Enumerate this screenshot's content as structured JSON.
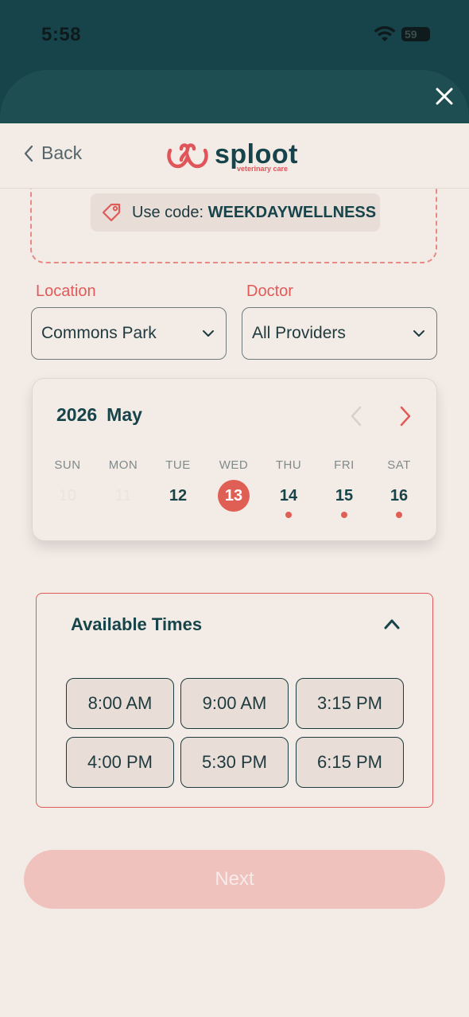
{
  "status_bar": {
    "time": "5:58",
    "battery": "59"
  },
  "header": {
    "back_label": "Back",
    "logo_word": "sploot",
    "logo_sub": "veterinary care"
  },
  "promo": {
    "prefix": "Use code: ",
    "code": "WEEKDAYWELLNESS"
  },
  "location": {
    "label": "Location",
    "value": "Commons Park"
  },
  "doctor": {
    "label": "Doctor",
    "value": "All Providers"
  },
  "calendar": {
    "year": "2026",
    "month": "May",
    "days": [
      {
        "name": "SUN",
        "num": "10",
        "state": "disabled",
        "has_dot": false
      },
      {
        "name": "MON",
        "num": "11",
        "state": "disabled",
        "has_dot": false
      },
      {
        "name": "TUE",
        "num": "12",
        "state": "normal",
        "has_dot": false
      },
      {
        "name": "WED",
        "num": "13",
        "state": "selected",
        "has_dot": false
      },
      {
        "name": "THU",
        "num": "14",
        "state": "normal",
        "has_dot": true
      },
      {
        "name": "FRI",
        "num": "15",
        "state": "normal",
        "has_dot": true
      },
      {
        "name": "SAT",
        "num": "16",
        "state": "normal",
        "has_dot": true
      }
    ]
  },
  "times": {
    "title": "Available Times",
    "slots": [
      "8:00 AM",
      "9:00 AM",
      "3:15 PM",
      "4:00 PM",
      "5:30 PM",
      "6:15 PM"
    ]
  },
  "next_label": "Next",
  "colors": {
    "accent": "#e05f55",
    "brand": "#17444a",
    "background": "#f3ebe6"
  }
}
